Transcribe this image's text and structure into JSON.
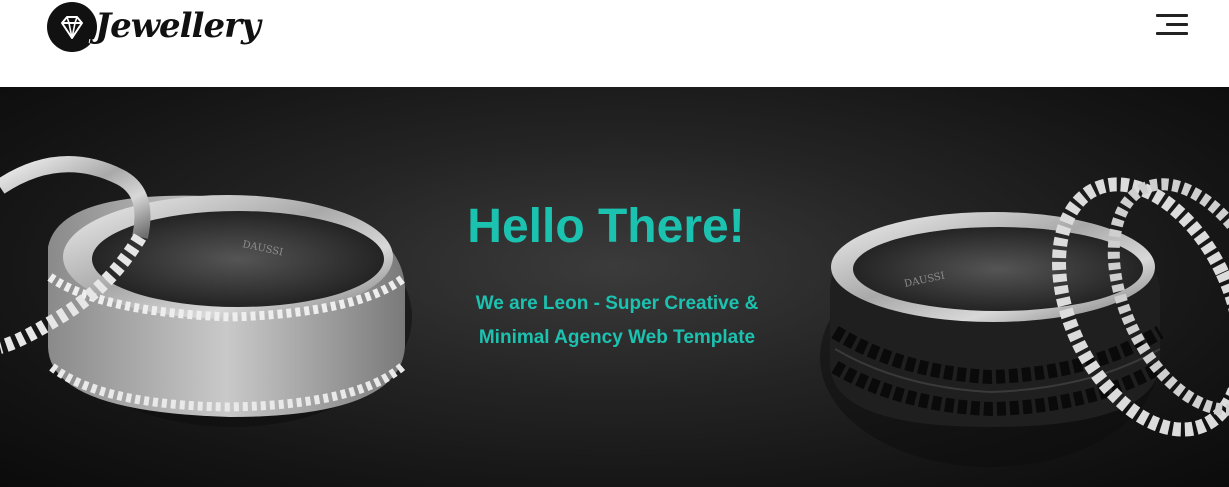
{
  "brand": {
    "name": "Jewellery",
    "logo_icon": "diamond-icon"
  },
  "header": {
    "menu_icon": "hamburger-menu-icon"
  },
  "hero": {
    "title": "Hello There!",
    "subtitle_line1": "We are Leon - Super Creative &",
    "subtitle_line2": "Minimal Agency Web Template",
    "image_text_left": "DAUSSI",
    "image_text_right": "DAUSSI"
  },
  "colors": {
    "accent": "#1cc2b0",
    "header_bg": "#ffffff",
    "hero_bg": "#1c1c1c",
    "logo": "#111111"
  }
}
